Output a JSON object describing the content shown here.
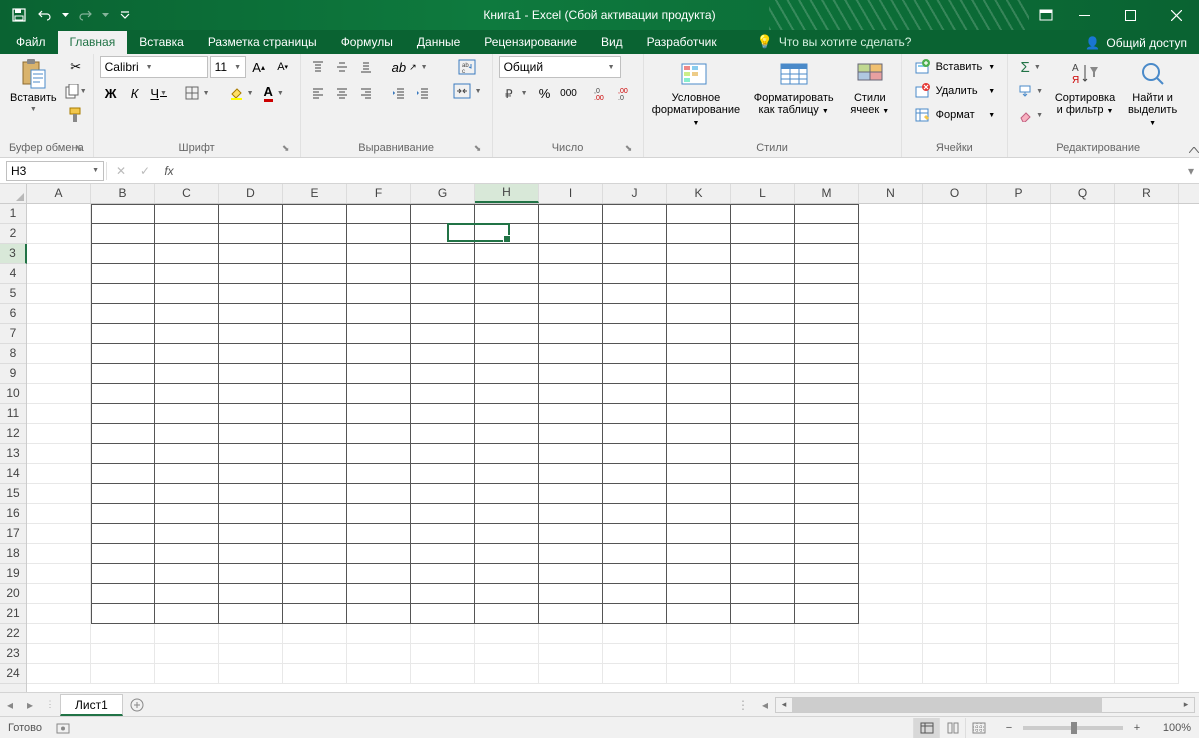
{
  "title": "Книга1 - Excel (Сбой активации продукта)",
  "tabs": {
    "file": "Файл",
    "home": "Главная",
    "insert": "Вставка",
    "pagelayout": "Разметка страницы",
    "formulas": "Формулы",
    "data": "Данные",
    "review": "Рецензирование",
    "view": "Вид",
    "developer": "Разработчик"
  },
  "tellme": "Что вы хотите сделать?",
  "share": "Общий доступ",
  "ribbon": {
    "clipboard": {
      "paste": "Вставить",
      "label": "Буфер обмена"
    },
    "font": {
      "name": "Calibri",
      "size": "11",
      "label": "Шрифт",
      "bold": "Ж",
      "italic": "К",
      "underline": "Ч"
    },
    "alignment": {
      "label": "Выравнивание"
    },
    "number": {
      "label": "Число",
      "format": "Общий",
      "percent": "%",
      "thousands": "000"
    },
    "styles": {
      "label": "Стили",
      "conditional": "Условное форматирование",
      "formatTable": "Форматировать как таблицу",
      "cellStyles": "Стили ячеек"
    },
    "cells": {
      "label": "Ячейки",
      "insert": "Вставить",
      "delete": "Удалить",
      "format": "Формат"
    },
    "editing": {
      "label": "Редактирование",
      "sort": "Сортировка и фильтр",
      "find": "Найти и выделить"
    }
  },
  "namebox": "H3",
  "active_cell": {
    "col": 7,
    "row": 2
  },
  "bordered_cols": [
    "B",
    "C",
    "D",
    "E",
    "F",
    "G",
    "H",
    "I",
    "J",
    "K",
    "L",
    "M"
  ],
  "bordered_rows": [
    1,
    2,
    3,
    4,
    5,
    6,
    7,
    8,
    9,
    10,
    11,
    12,
    13,
    14,
    15,
    16,
    17,
    18,
    19,
    20,
    21
  ],
  "columns": [
    "A",
    "B",
    "C",
    "D",
    "E",
    "F",
    "G",
    "H",
    "I",
    "J",
    "K",
    "L",
    "M",
    "N",
    "O",
    "P",
    "Q",
    "R"
  ],
  "rows": [
    1,
    2,
    3,
    4,
    5,
    6,
    7,
    8,
    9,
    10,
    11,
    12,
    13,
    14,
    15,
    16,
    17,
    18,
    19,
    20,
    21,
    22,
    23,
    24
  ],
  "sheetTab": "Лист1",
  "status": "Готово",
  "zoom": "100%"
}
